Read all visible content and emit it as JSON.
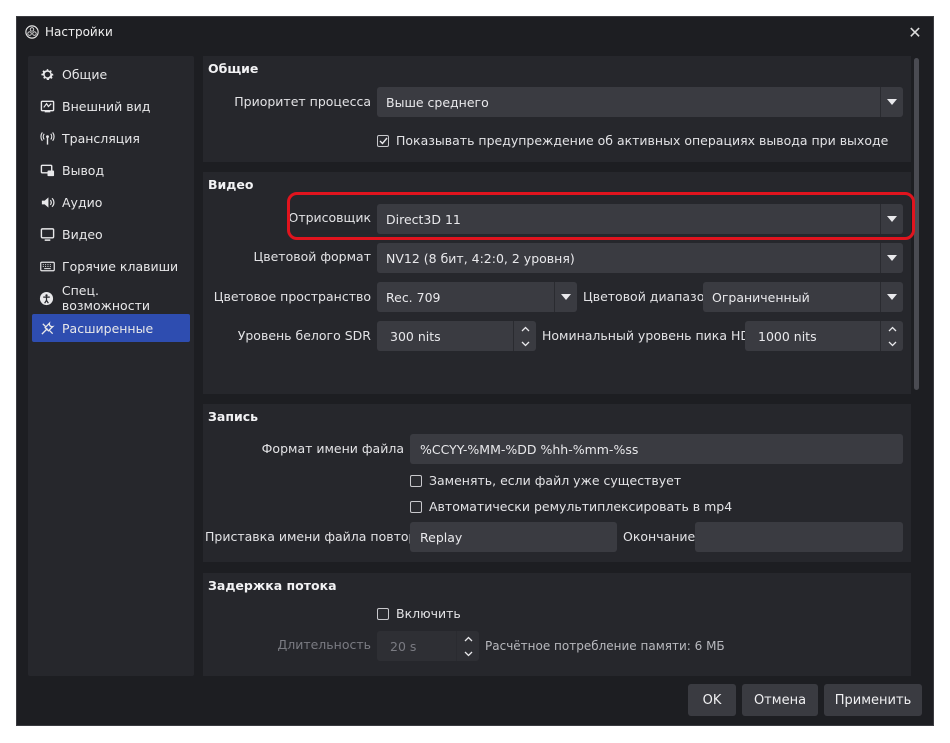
{
  "window": {
    "title": "Настройки"
  },
  "sidebar": {
    "items": [
      {
        "label": "Общие",
        "icon": "gear-icon"
      },
      {
        "label": "Внешний вид",
        "icon": "appearance-icon"
      },
      {
        "label": "Трансляция",
        "icon": "broadcast-icon"
      },
      {
        "label": "Вывод",
        "icon": "output-icon"
      },
      {
        "label": "Аудио",
        "icon": "speaker-icon"
      },
      {
        "label": "Видео",
        "icon": "monitor-icon"
      },
      {
        "label": "Горячие клавиши",
        "icon": "keyboard-icon"
      },
      {
        "label": "Спец. возможности",
        "icon": "accessibility-icon"
      },
      {
        "label": "Расширенные",
        "icon": "tools-icon"
      }
    ],
    "active_index": 8
  },
  "general": {
    "title": "Общие",
    "priority_label": "Приоритет процесса",
    "priority_value": "Выше среднего",
    "warn_checkbox_label": "Показывать предупреждение об активных операциях вывода при выходе",
    "warn_checked": true
  },
  "video": {
    "title": "Видео",
    "renderer_label": "Отрисовщик",
    "renderer_value": "Direct3D 11",
    "color_format_label": "Цветовой формат",
    "color_format_value": "NV12 (8 бит, 4:2:0, 2 уровня)",
    "color_space_label": "Цветовое пространство",
    "color_space_value": "Rec. 709",
    "color_range_label": "Цветовой диапазон",
    "color_range_value": "Ограниченный",
    "sdr_white_label": "Уровень белого SDR",
    "sdr_white_value": "300 nits",
    "hdr_peak_label": "Номинальный уровень пика HDR",
    "hdr_peak_value": "1000 nits"
  },
  "recording": {
    "title": "Запись",
    "filename_format_label": "Формат имени файла",
    "filename_format_value": "%CCYY-%MM-%DD %hh-%mm-%ss",
    "overwrite_label": "Заменять, если файл уже существует",
    "overwrite_checked": false,
    "remux_label": "Автоматически ремультиплексировать в mp4",
    "remux_checked": false,
    "replay_prefix_label": "Приставка имени файла повтора",
    "replay_prefix_value": "Replay",
    "suffix_label": "Окончание",
    "suffix_value": ""
  },
  "stream_delay": {
    "title": "Задержка потока",
    "enable_label": "Включить",
    "enable_checked": false,
    "duration_label": "Длительность",
    "duration_value": "20 s",
    "memory_text": "Расчётное потребление памяти: 6 МБ"
  },
  "buttons": {
    "ok": "OK",
    "cancel": "Отмена",
    "apply": "Применить"
  },
  "colors": {
    "accent": "#2e4db0",
    "highlight": "#e0141e",
    "background": "#1d1e22",
    "panel": "#26272c",
    "field": "#3a3b41"
  }
}
